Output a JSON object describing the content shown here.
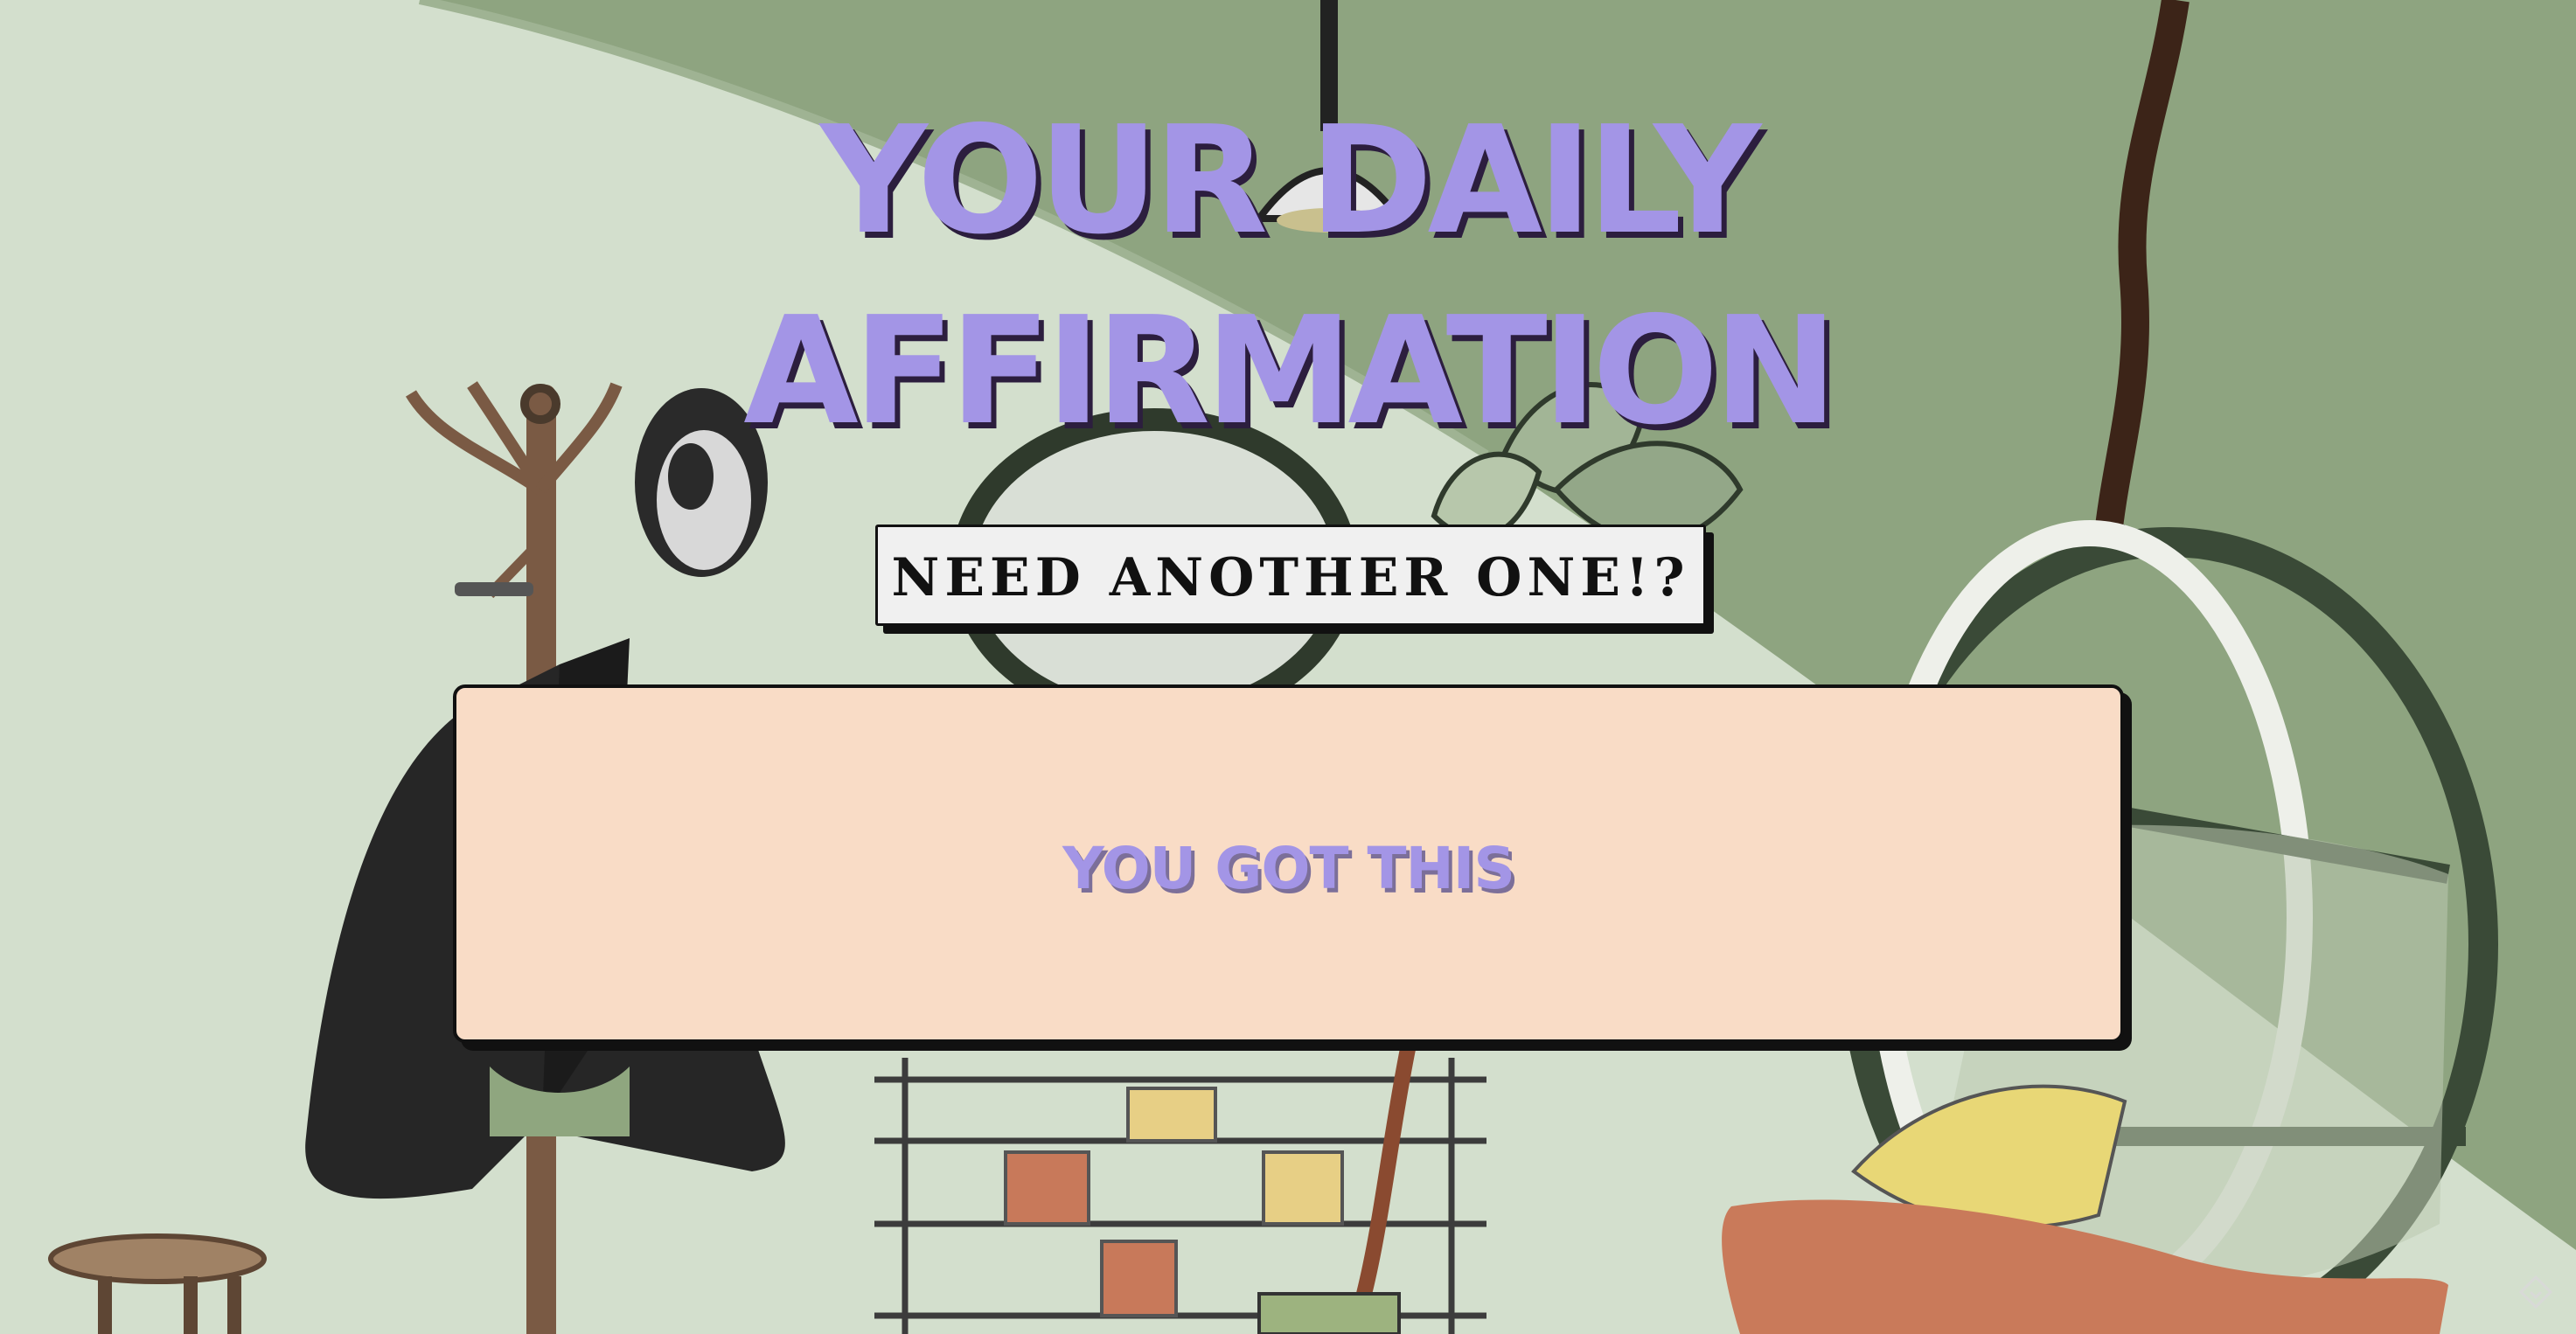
{
  "header": {
    "title_line1": "YOUR DAILY",
    "title_line2": "AFFIRMATION"
  },
  "actions": {
    "another_label": "NEED ANOTHER ONE!?"
  },
  "affirmation": {
    "text": "YOU GOT THIS"
  },
  "colors": {
    "title": "#a395e6",
    "card_background": "#f9dcc6",
    "button_background": "#f0f0f0",
    "wall_light": "#d3dfcd",
    "wall_dark": "#8ea480"
  },
  "icons": {
    "corner": "diamond-icon"
  }
}
